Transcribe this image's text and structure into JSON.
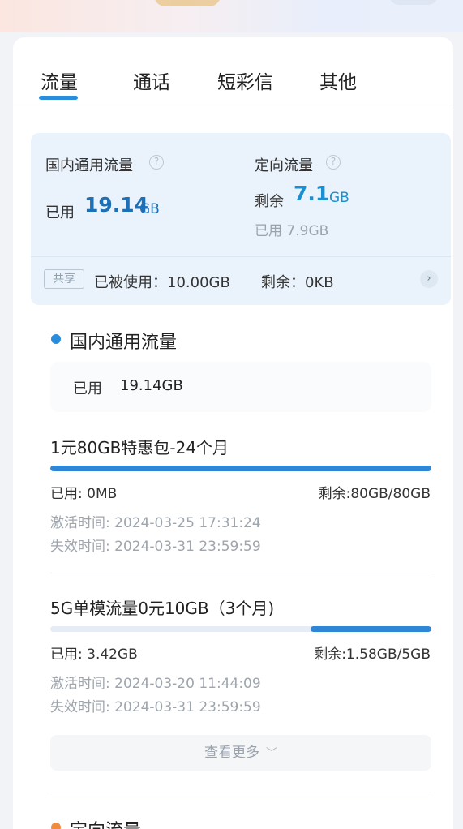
{
  "tabs": [
    {
      "label": "流量",
      "active": true
    },
    {
      "label": "通话",
      "active": false
    },
    {
      "label": "短彩信",
      "active": false
    },
    {
      "label": "其他",
      "active": false
    }
  ],
  "summary": {
    "domestic_label": "国内通用流量",
    "domestic_used_prefix": "已用",
    "domestic_used_value": "19.14",
    "domestic_used_unit": "GB",
    "directed_label": "定向流量",
    "directed_remain_prefix": "剩余",
    "directed_remain_value": "7.1",
    "directed_remain_unit": "GB",
    "directed_used": "已用 7.9GB",
    "share_badge": "共享",
    "share_used": "已被使用：10.00GB",
    "share_remain": "剩余：0KB"
  },
  "domestic_section": {
    "title": "国内通用流量",
    "used_label": "已用",
    "used_value": "19.14GB"
  },
  "packages": [
    {
      "name": "1元80GB特惠包-24个月",
      "used": "已用: 0MB",
      "remain": "剩余:80GB/80GB",
      "remain_fraction": 1.0,
      "activated": "激活时间: 2024-03-25 17:31:24",
      "expires": "失效时间: 2024-03-31 23:59:59"
    },
    {
      "name": "5G单模流量0元10GB（3个月)",
      "used": "已用: 3.42GB",
      "remain": "剩余:1.58GB/5GB",
      "remain_fraction": 0.316,
      "activated": "激活时间: 2024-03-20 11:44:09",
      "expires": "失效时间: 2024-03-31 23:59:59"
    }
  ],
  "more_label": "查看更多",
  "directed_section": {
    "title": "定向流量"
  },
  "colors": {
    "accent": "#2a8ddc",
    "progress": "#2f86d6",
    "orange_dot": "#f08a3c"
  },
  "icons": {
    "help": "help-icon",
    "arrow": "chevron-right-icon",
    "more": "chevron-down-icon"
  }
}
